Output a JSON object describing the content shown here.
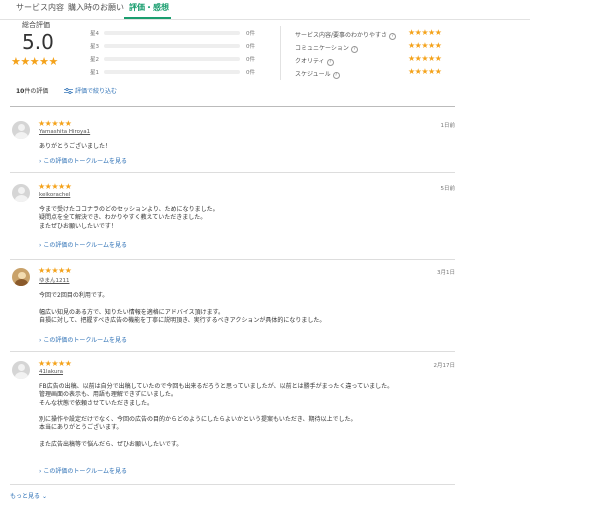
{
  "tabs": [
    {
      "label": "サービス内容",
      "active": false
    },
    {
      "label": "購入時のお願い",
      "active": false
    },
    {
      "label": "評価・感想",
      "active": true
    }
  ],
  "summary": {
    "overall_label": "総合評価",
    "overall_score": "5.0",
    "overall_stars": "★★★★★",
    "distribution": [
      {
        "label": "星4",
        "count": "0件",
        "fraction": 0
      },
      {
        "label": "星3",
        "count": "0件",
        "fraction": 0
      },
      {
        "label": "星2",
        "count": "0件",
        "fraction": 0
      },
      {
        "label": "星1",
        "count": "0件",
        "fraction": 0
      }
    ],
    "aspects": [
      {
        "label": "サービス内容/要事のわかりやすさ",
        "stars": "★★★★★",
        "rating": 5
      },
      {
        "label": "コミュニケーション",
        "stars": "★★★★★",
        "rating": 5
      },
      {
        "label": "クオリティ",
        "stars": "★★★★★",
        "rating": 5
      },
      {
        "label": "スケジュール",
        "stars": "★★★★★",
        "rating": 5
      }
    ],
    "help_glyph": "?",
    "review_count_number": "10",
    "review_count_suffix": "件の評価",
    "filter_label": "評価で絞り込む"
  },
  "reviews": [
    {
      "stars": "★★★★★",
      "user": "Yamashita Hiroya1",
      "date": "1日前",
      "lines": [
        "ありがとうございました！"
      ],
      "link": "この評価のトークルームを見る"
    },
    {
      "stars": "★★★★★",
      "user": "keikorachel",
      "date": "5日前",
      "lines": [
        "今まで受けたココナラのどのセッションより、ためになりました。",
        "疑問点を全て解決でき、わかりやすく教えていただきました。",
        "またぜひお願いしたいです！"
      ],
      "link": "この評価のトークルームを見る"
    },
    {
      "stars": "★★★★★",
      "user": "ゆまん1211",
      "date": "3月1日",
      "lines": [
        "今回で2回目の利用です。",
        "",
        "幅広い知見のある方で、知りたい情報を適格にアドバイス頂けます。",
        "自損に対して、把握すべき広告の機能を丁寧に説明頂き、実行するべきアクションが具体的になりました。"
      ],
      "link": "この評価のトークルームを見る"
    },
    {
      "stars": "★★★★★",
      "user": "41lakura",
      "date": "2月17日",
      "lines": [
        "FB広告の出稿、以前は自分で出稿していたので今回も出来るだろうと思っていましたが、以前とは勝手がまったく違っていました。",
        "管理画面の表示も、用語も理解できずにいました。",
        "そんな状態で依頼させていただきました。",
        "",
        "別に操作や設定だけでなく、今回の広告の目的からどのようにしたらよいかという提案もいただき、期待以上でした。",
        "本当にありがとうございます。",
        "",
        "また広告出稿等で悩んだら、ぜひお願いしたいです。"
      ],
      "link": "この評価のトークルームを見る"
    }
  ],
  "more_label": "もっと見る",
  "colors": {
    "accent": "#1a9e6f",
    "star": "#f4a21a",
    "link": "#2b6fb5"
  }
}
